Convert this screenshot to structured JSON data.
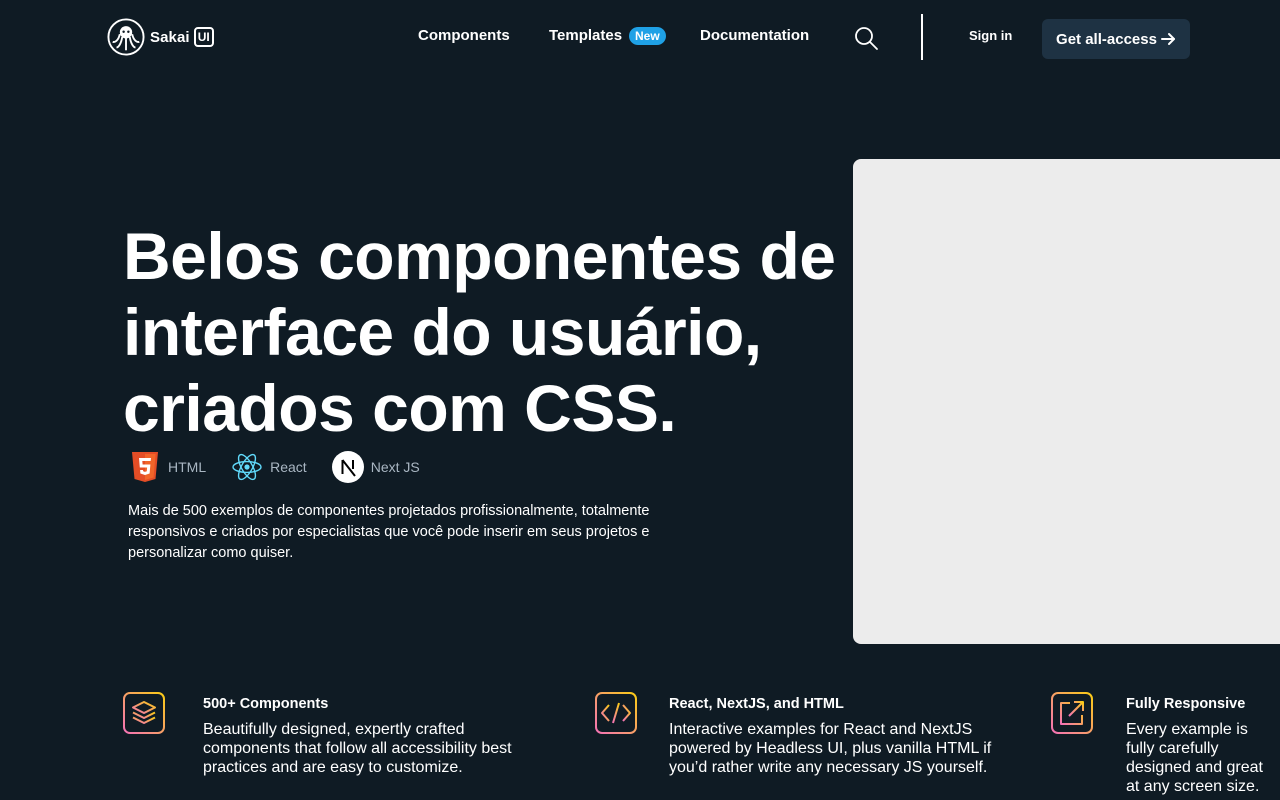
{
  "header": {
    "brand": "Sakai",
    "brand_badge": "UI",
    "nav": {
      "components": "Components",
      "templates": "Templates",
      "templates_badge": "New",
      "documentation": "Documentation"
    },
    "sign_in": "Sign in",
    "cta": "Get all-access"
  },
  "hero": {
    "title_line1": "Belos componentes de",
    "title_line2": "interface do usuário,",
    "title_line3": "criados com CSS.",
    "tech": [
      {
        "label": "HTML",
        "icon": "html5-icon"
      },
      {
        "label": "React",
        "icon": "react-icon"
      },
      {
        "label": "Next JS",
        "icon": "nextjs-icon"
      }
    ],
    "description": "Mais de 500 exemplos de componentes projetados profissionalmente, totalmente responsivos e criados por especialistas que você pode inserir em seus projetos e personalizar como quiser."
  },
  "features": [
    {
      "title": "500+ Components",
      "description": "Beautifully designed, expertly crafted components that follow all accessibility best practices and are easy to customize.",
      "icon": "layers-icon"
    },
    {
      "title": "React, NextJS, and HTML",
      "description": "Interactive examples for React and NextJS powered by Headless UI, plus vanilla HTML if you’d rather write any necessary JS yourself.",
      "icon": "code-icon"
    },
    {
      "title": "Fully Responsive",
      "description": "Every example is fully carefully designed and great at any screen size.",
      "icon": "external-link-icon"
    }
  ],
  "colors": {
    "background": "#0f1b24",
    "badge": "#1fa1e6",
    "cta_background": "#1e3243",
    "hero_media": "#ececec",
    "gradient_start": "#f472b6",
    "gradient_end": "#facc15"
  }
}
